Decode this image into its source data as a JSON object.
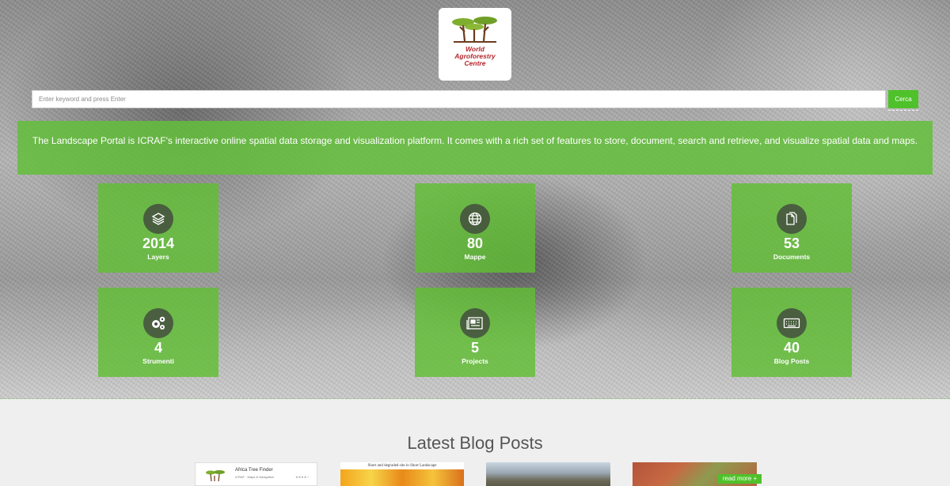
{
  "logo": {
    "line1": "World",
    "line2": "Agroforestry",
    "line3": "Centre"
  },
  "search": {
    "placeholder": "Enter keyword and press Enter",
    "button_label": "Cerca"
  },
  "intro": {
    "text": "The Landscape Portal is ICRAF's interactive online spatial data storage and visualization platform. It comes with a rich set of features to store, document, search and retrieve, and visualize spatial data and maps."
  },
  "stats": [
    {
      "count": "2014",
      "label": "Layers",
      "icon": "layers-icon"
    },
    {
      "count": "80",
      "label": "Mappe",
      "icon": "globe-icon"
    },
    {
      "count": "53",
      "label": "Documents",
      "icon": "documents-icon"
    },
    {
      "count": "4",
      "label": "Strumenti",
      "icon": "cogs-icon"
    },
    {
      "count": "5",
      "label": "Projects",
      "icon": "newspaper-icon"
    },
    {
      "count": "40",
      "label": "Blog Posts",
      "icon": "keyboard-icon"
    }
  ],
  "blog": {
    "title": "Latest Blog Posts",
    "cards": [
      {
        "title": "Africa Tree Finder",
        "subtitle": "ICRAF · Maps & Navigation",
        "rating": "★★★★☆"
      },
      {
        "caption": "Short and degraded site in Short Landscape"
      },
      {},
      {}
    ],
    "read_more": "read more +"
  },
  "colors": {
    "accent_green": "#4fc12a",
    "tile_green": "#60be34",
    "logo_red": "#b3262b"
  }
}
